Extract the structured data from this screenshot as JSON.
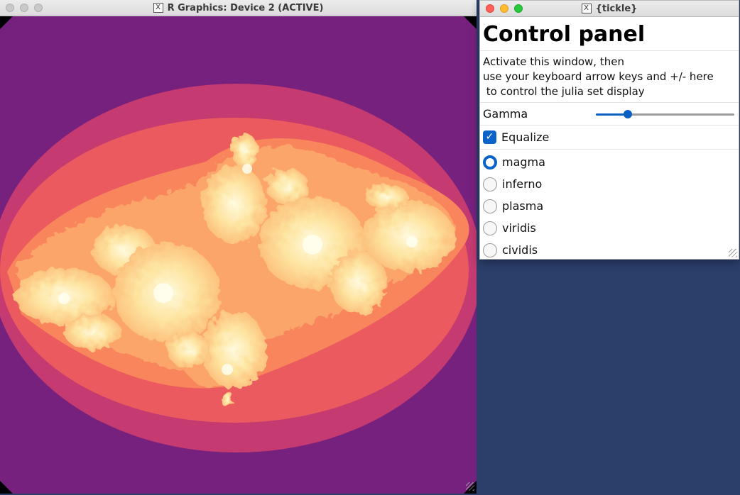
{
  "graphics_window": {
    "title": "R Graphics: Device 2 (ACTIVE)",
    "x_icon": "X"
  },
  "panel_window": {
    "title": "{tickle}",
    "x_icon": "X",
    "heading": "Control panel",
    "instructions": "Activate this window, then\nuse your keyboard arrow keys and +/- here\n to control the julia set display",
    "gamma": {
      "label": "Gamma",
      "value_fraction": 0.23
    },
    "equalize": {
      "label": "Equalize",
      "checked": true,
      "check_glyph": "✓"
    },
    "palettes": [
      {
        "label": "magma",
        "selected": true
      },
      {
        "label": "inferno",
        "selected": false
      },
      {
        "label": "plasma",
        "selected": false
      },
      {
        "label": "viridis",
        "selected": false
      },
      {
        "label": "cividis",
        "selected": false
      }
    ]
  },
  "colors": {
    "desktop": "#2b3f6b",
    "accent": "#0a63c9",
    "magma": [
      "#000004",
      "#77217e",
      "#c43a71",
      "#ea5a5e",
      "#f9855c",
      "#fdb875",
      "#fcfdbf"
    ]
  }
}
